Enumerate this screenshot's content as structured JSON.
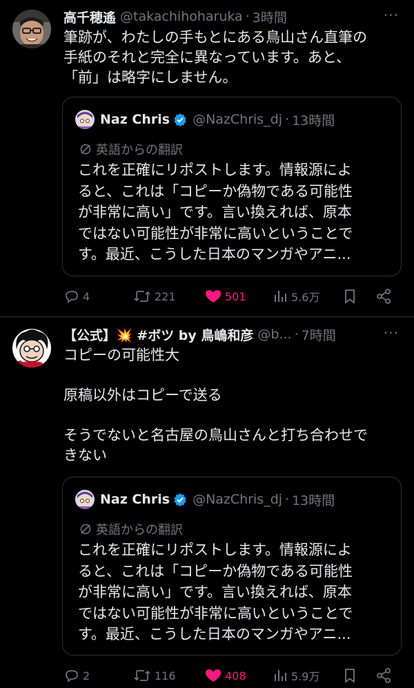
{
  "tweets": [
    {
      "author": {
        "name": "高千穂遙",
        "handle": "@takachihoharuka",
        "time": "3時間"
      },
      "text": "筆跡が、わたしの手もとにある鳥山さん直筆の\n手紙のそれと完全に異なっています。あと、\n「前」は略字にしません。",
      "quote": {
        "name": "Naz Chris",
        "handle": "@NazChris_dj",
        "time": "13時間",
        "translation_label": "英語からの翻訳",
        "text": "これを正確にリポストします。情報源によ\nると、これは「コピーか偽物である可能性\nが非常に高い」です。言い換えれば、原本\nではない可能性が非常に高いということで\nす。最近、こうした日本のマンガやアニ..."
      },
      "stats": {
        "replies": "4",
        "retweets": "221",
        "likes": "501",
        "views": "5.6万"
      }
    },
    {
      "author": {
        "name": "【公式】💥 #ボツ by 鳥嶋和彦",
        "handle": "@b...",
        "time": "7時間"
      },
      "text": "コピーの可能性大\n\n原稿以外はコピーで送る\n\nそうでないと名古屋の鳥山さんと打ち合わせで\nきない",
      "quote": {
        "name": "Naz Chris",
        "handle": "@NazChris_dj",
        "time": "13時間",
        "translation_label": "英語からの翻訳",
        "text": "これを正確にリポストします。情報源によ\nると、これは「コピーか偽物である可能性\nが非常に高い」です。言い換えれば、原本\nではない可能性が非常に高いということで\nす。最近、こうした日本のマンガやアニ..."
      },
      "stats": {
        "replies": "2",
        "retweets": "116",
        "likes": "408",
        "views": "5.9万"
      }
    }
  ],
  "ui": {
    "more_label": "···",
    "dot": "·"
  },
  "colors": {
    "background": "#000000",
    "text": "#e7e9ea",
    "muted": "#71767b",
    "like": "#f91880",
    "verified": "#1d9bf0",
    "border": "#2f3336"
  },
  "icons": [
    "reply-icon",
    "retweet-icon",
    "heart-icon",
    "views-icon",
    "bookmark-icon",
    "share-icon",
    "verified-badge-icon",
    "translate-icon",
    "more-icon"
  ]
}
